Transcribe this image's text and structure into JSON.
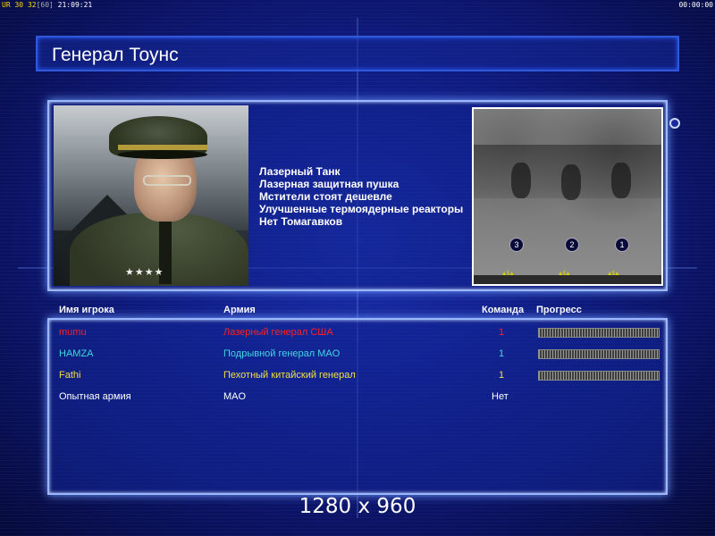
{
  "hud": {
    "left_prefix": "UR",
    "left_a": "30",
    "left_b": "32",
    "left_c": "[60]",
    "left_time": "21:09:21",
    "right_time": "00:00:00"
  },
  "general": {
    "name": "Генерал Тоунс",
    "features": [
      "Лазерный Танк",
      "Лазерная защитная пушка",
      "Мстители стоят дешевле",
      "Улучшенные термоядерные реакторы",
      "Нет Томагавков"
    ]
  },
  "minimap": {
    "spots": [
      "3",
      "2",
      "1"
    ]
  },
  "table": {
    "headers": {
      "player": "Имя игрока",
      "army": "Армия",
      "team": "Команда",
      "progress": "Прогресс"
    },
    "rows": [
      {
        "player": "mumu",
        "army": "Лазерный генерал США",
        "team": "1",
        "progress": 1.0,
        "color": "#ff2020"
      },
      {
        "player": "HAMZA",
        "army": "Подрывной генерал MAO",
        "team": "1",
        "progress": 1.0,
        "color": "#40d8e0"
      },
      {
        "player": "Fathi",
        "army": "Пехотный китайский генерал",
        "team": "1",
        "progress": 1.0,
        "color": "#f0e040"
      },
      {
        "player": "Опытная армия",
        "army": "MAO",
        "team": "Нет",
        "progress": null,
        "color": "#ffffff"
      }
    ]
  },
  "resolution_text": "1280 x 960"
}
